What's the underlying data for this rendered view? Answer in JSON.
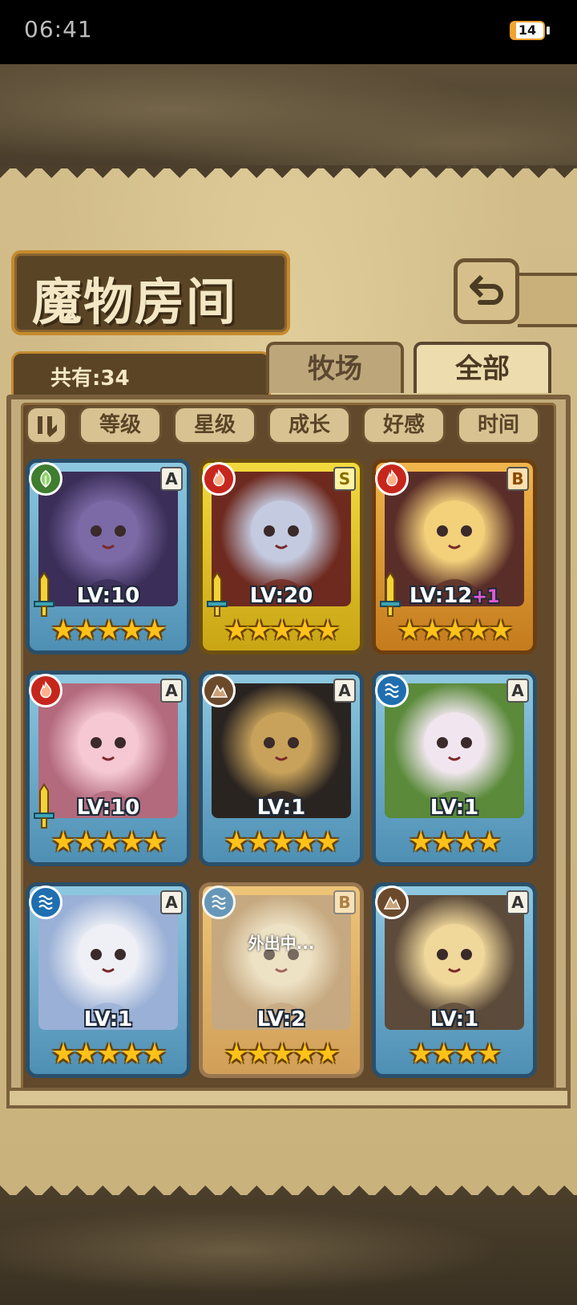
{
  "status_bar": {
    "time": "06:41",
    "battery": "14",
    "battery_level": 0.14
  },
  "header": {
    "title": "魔物房间"
  },
  "tabs": {
    "count_label": "共有:34",
    "ranch": "牧场",
    "all": "全部"
  },
  "sort": [
    "等级",
    "星级",
    "成长",
    "好感",
    "时间"
  ],
  "colors": {
    "frame_blue": "#4e8fb4",
    "frame_gold": "#c9a514",
    "frame_bronze": "#c47b1d",
    "star": "#ffc21a"
  },
  "cards": [
    {
      "element": "grass-icon",
      "rank": "A",
      "level": "LV:10",
      "plus": "",
      "stars": "★★★★★",
      "equipped": true,
      "frame": "blue",
      "art": [
        "#3b2e58",
        "#7c6aa6"
      ],
      "away": ""
    },
    {
      "element": "fire-icon",
      "rank": "S",
      "level": "LV:20",
      "plus": "",
      "stars": "★★★★★",
      "equipped": true,
      "frame": "gold",
      "art": [
        "#6e2a1f",
        "#c4cbe0"
      ],
      "away": ""
    },
    {
      "element": "fire-icon",
      "rank": "B",
      "level": "LV:12",
      "plus": "+1",
      "stars": "★★★★★",
      "equipped": true,
      "frame": "bronze",
      "art": [
        "#5a2e28",
        "#f3d07a"
      ],
      "away": ""
    },
    {
      "element": "fire-icon",
      "rank": "A",
      "level": "LV:10",
      "plus": "",
      "stars": "★★★★★",
      "equipped": true,
      "frame": "blue",
      "art": [
        "#b36a7d",
        "#f5c8d4"
      ],
      "away": ""
    },
    {
      "element": "earth-icon",
      "rank": "A",
      "level": "LV:1",
      "plus": "",
      "stars": "★★★★★",
      "equipped": false,
      "frame": "blue",
      "art": [
        "#2a2421",
        "#c8a25a"
      ],
      "away": ""
    },
    {
      "element": "water-icon",
      "rank": "A",
      "level": "LV:1",
      "plus": "",
      "stars": "★★★★",
      "equipped": false,
      "frame": "blue",
      "art": [
        "#5a8a3a",
        "#f1e6ee"
      ],
      "away": ""
    },
    {
      "element": "water-icon",
      "rank": "A",
      "level": "LV:1",
      "plus": "",
      "stars": "★★★★★",
      "equipped": false,
      "frame": "blue",
      "art": [
        "#9ab0d6",
        "#eef0f6"
      ],
      "away": ""
    },
    {
      "element": "water-icon",
      "rank": "B",
      "level": "LV:2",
      "plus": "",
      "stars": "★★★★★",
      "equipped": false,
      "frame": "bronze",
      "art": [
        "#b28a5a",
        "#f0e2c4"
      ],
      "away": "外出中..."
    },
    {
      "element": "earth-icon",
      "rank": "A",
      "level": "LV:1",
      "plus": "",
      "stars": "★★★★",
      "equipped": false,
      "frame": "blue",
      "art": [
        "#5c4a3a",
        "#f0d79a"
      ],
      "away": ""
    }
  ]
}
